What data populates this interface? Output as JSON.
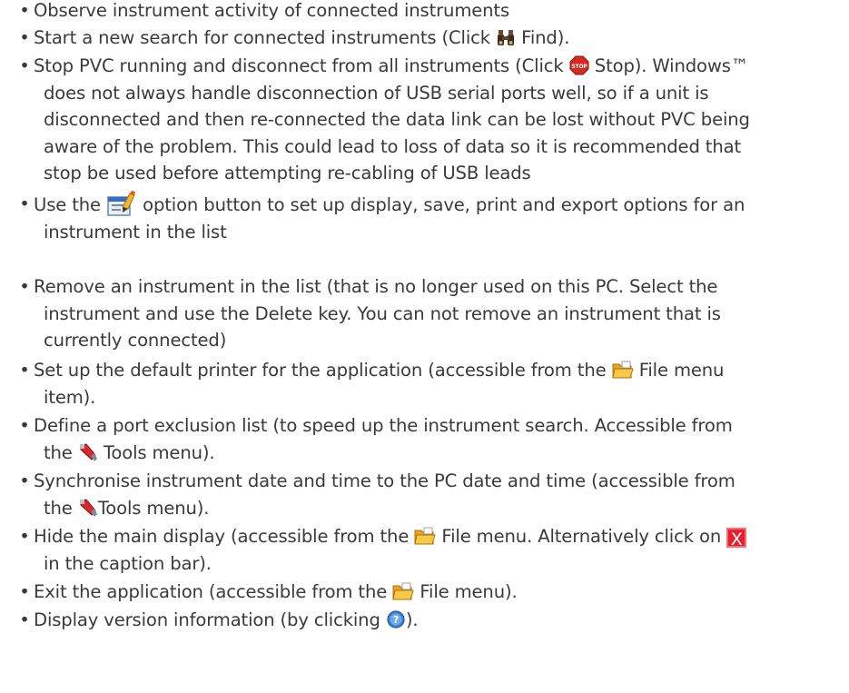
{
  "bullets": {
    "b1": {
      "t1": "Observe instrument activity of connected instruments"
    },
    "b2": {
      "t1": "Start a new search for connected instruments (Click",
      "t2": "Find)."
    },
    "b3": {
      "t1": "Stop PVC running and disconnect from all instruments (Click",
      "t2": "Stop). Windows™",
      "l2": "does not always handle disconnection of USB serial ports well, so if a unit is",
      "l3": "disconnected and then re-connected the data link can be lost without PVC being",
      "l4": "aware of the problem. This could lead to loss of data so it is recommended that",
      "l5": "stop be used before attempting re-cabling of USB leads"
    },
    "b4": {
      "t1": "Use the",
      "t2": "option button to set up display, save, print and export options for an",
      "l2": "instrument in the list"
    },
    "b5": {
      "t1": "Remove an instrument in the list (that is no longer used on this PC. Select the",
      "l2": "instrument and use the Delete key. You can not remove an instrument that is",
      "l3": "currently connected)"
    },
    "b6": {
      "t1": "Set up the default printer for the application (accessible from the",
      "t2": "File menu",
      "l2": "item)."
    },
    "b7": {
      "t1": "Define a port exclusion list (to speed up the instrument search. Accessible from",
      "l2a": "the",
      "l2b": "Tools menu)."
    },
    "b8": {
      "t1": "Synchronise instrument date and time to the PC date and time (accessible from",
      "l2a": "the",
      "l2b": "Tools menu)."
    },
    "b9": {
      "t1": "Hide the main display (accessible from the",
      "t2": "File menu. Alternatively click on",
      "x": "X",
      "l2": "in the caption bar)."
    },
    "b10": {
      "t1": "Exit the application (accessible from the",
      "t2": "File menu)."
    },
    "b11": {
      "t1": "Display version information (by clicking",
      "t2": ")."
    }
  },
  "icons": {
    "find": "binoculars-icon",
    "stop": "stop-sign-icon",
    "options": "options-icon",
    "file": "folder-icon",
    "tools": "tools-icon",
    "close": "close-icon",
    "help": "help-icon"
  },
  "colors": {
    "text": "#3a3a3a",
    "close_red": "#e4202c"
  }
}
